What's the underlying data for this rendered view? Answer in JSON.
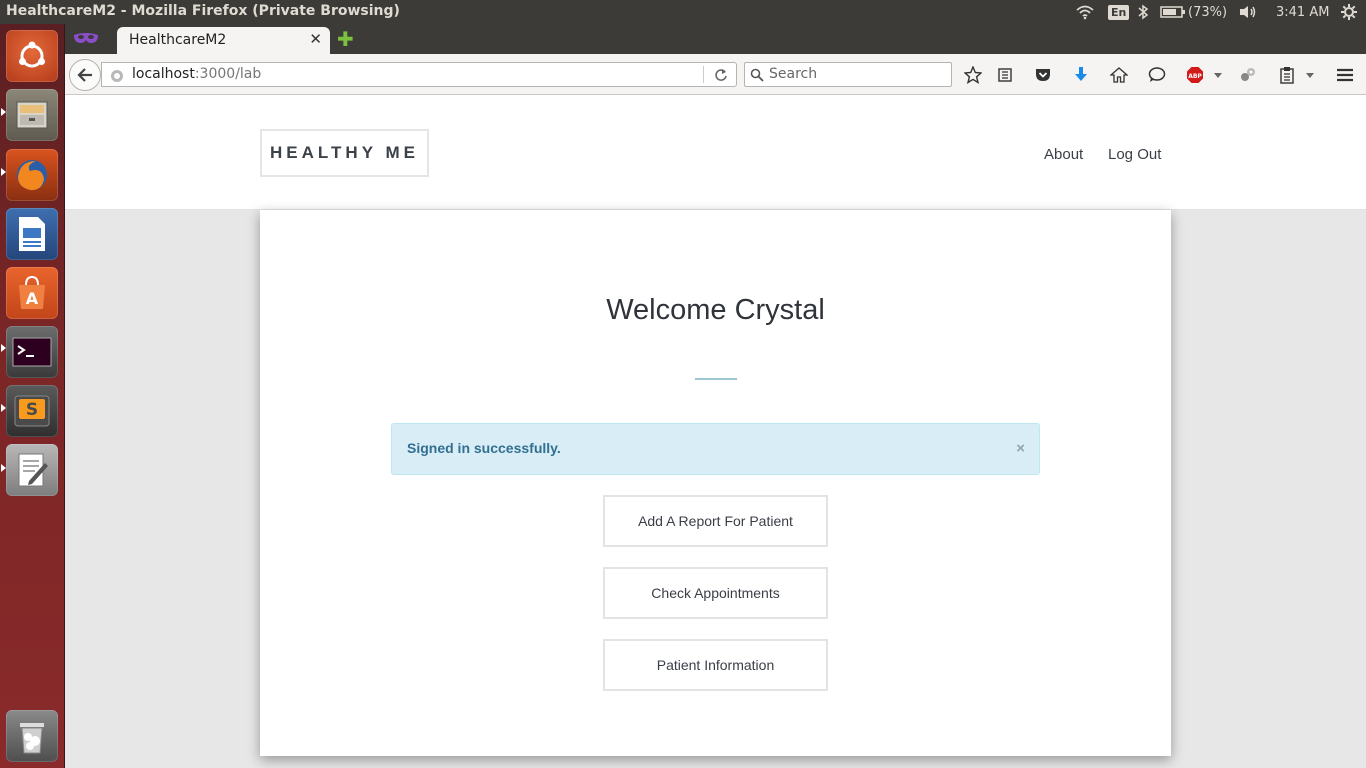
{
  "window": {
    "title": "HealthcareM2 - Mozilla Firefox (Private Browsing)"
  },
  "system_tray": {
    "language": "En",
    "battery": "(73%)",
    "clock": "3:41 AM"
  },
  "launcher": {
    "apps": [
      "ubuntu-dash",
      "files",
      "firefox",
      "libreoffice-writer",
      "software-center",
      "terminal",
      "sublime-text",
      "text-editor",
      "trash"
    ]
  },
  "browser": {
    "tab": {
      "title": "HealthcareM2"
    },
    "url": {
      "host": "localhost",
      "path": ":3000/lab"
    },
    "search": {
      "placeholder": "Search"
    }
  },
  "site": {
    "brand": "HEALTHY ME",
    "nav": {
      "about": "About",
      "logout": "Log Out"
    }
  },
  "main": {
    "heading": "Welcome Crystal",
    "alert": {
      "message": "Signed in successfully.",
      "close": "×"
    },
    "actions": {
      "add_report": "Add A Report For Patient",
      "check_appointments": "Check Appointments",
      "patient_information": "Patient Information"
    }
  },
  "colors": {
    "alert_bg": "#d9edf7",
    "alert_text": "#31708f",
    "divider": "#9dc7cf",
    "launcher": "#7a2526"
  }
}
